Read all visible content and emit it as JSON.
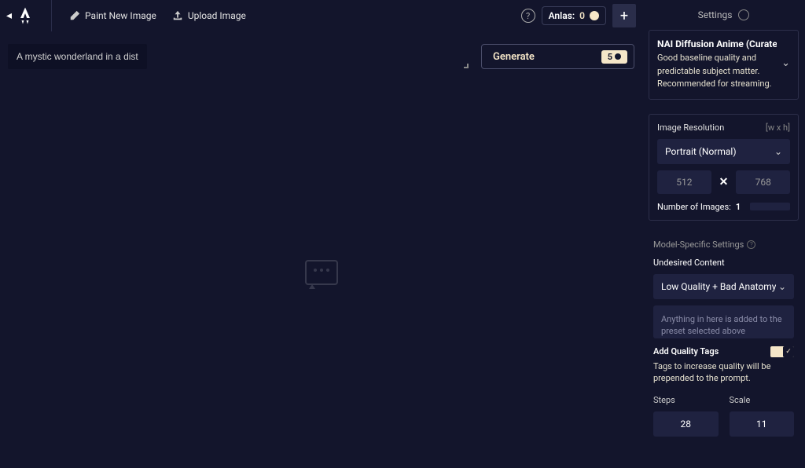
{
  "topbar": {
    "paint_label": "Paint New Image",
    "upload_label": "Upload Image",
    "anlas_label": "Anlas:",
    "anlas_value": "0"
  },
  "prompt": {
    "text": "A mystic wonderland in a distant galaxy in the middle of a thunderstorm surrounded by high mountains"
  },
  "generate": {
    "label": "Generate",
    "cost": "5"
  },
  "sidebar": {
    "settings_label": "Settings",
    "model": {
      "title": "NAI Diffusion Anime (Curated)",
      "desc": "Good baseline quality and predictable subject matter. Recommended for streaming."
    },
    "resolution": {
      "label": "Image Resolution",
      "hint": "[w x h]",
      "selected": "Portrait (Normal)",
      "width": "512",
      "height": "768"
    },
    "num_images": {
      "label": "Number of Images:",
      "value": "1"
    },
    "model_specific_label": "Model-Specific Settings",
    "undesired": {
      "label": "Undesired Content",
      "selected": "Low Quality + Bad Anatomy",
      "placeholder": "Anything in here is added to the preset selected above"
    },
    "quality": {
      "label": "Add Quality Tags",
      "desc": "Tags to increase quality will be prepended to the prompt.",
      "enabled": true
    },
    "steps": {
      "label": "Steps",
      "value": "28"
    },
    "scale": {
      "label": "Scale",
      "value": "11"
    }
  }
}
